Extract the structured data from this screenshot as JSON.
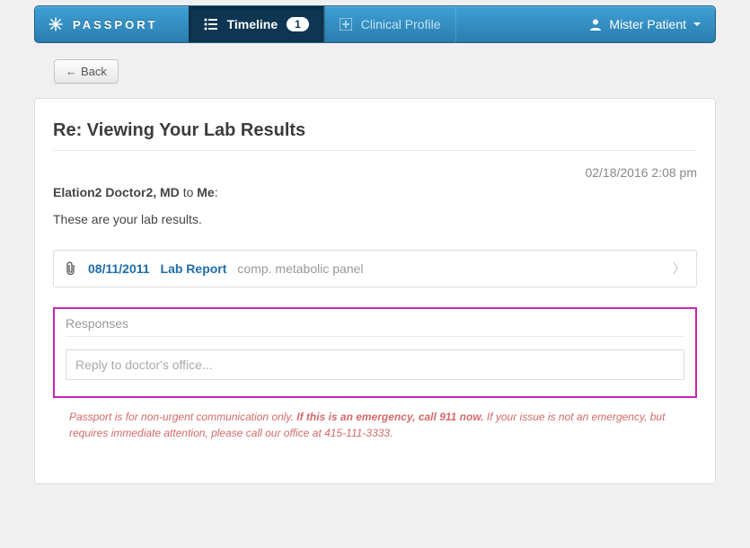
{
  "header": {
    "brand": "PASSPORT",
    "tabs": {
      "timeline": {
        "label": "Timeline",
        "badge": "1"
      },
      "clinical": {
        "label": "Clinical Profile"
      }
    },
    "user_name": "Mister Patient"
  },
  "back_button": "Back",
  "message": {
    "subject": "Re: Viewing Your Lab Results",
    "timestamp": "02/18/2016 2:08 pm",
    "sender": "Elation2 Doctor2, MD",
    "to_word": "to",
    "recipient": "Me",
    "body": "These are your lab results.",
    "attachment": {
      "date": "08/11/2011",
      "type": "Lab Report",
      "description": "comp. metabolic panel"
    }
  },
  "responses": {
    "heading": "Responses",
    "placeholder": "Reply to doctor's office..."
  },
  "disclaimer": {
    "part1": "Passport is for non-urgent communication only. ",
    "bold": "If this is an emergency, call 911 now.",
    "part2": " If your issue is not an emergency, but requires immediate attention, please call our office at 415-111-3333."
  }
}
